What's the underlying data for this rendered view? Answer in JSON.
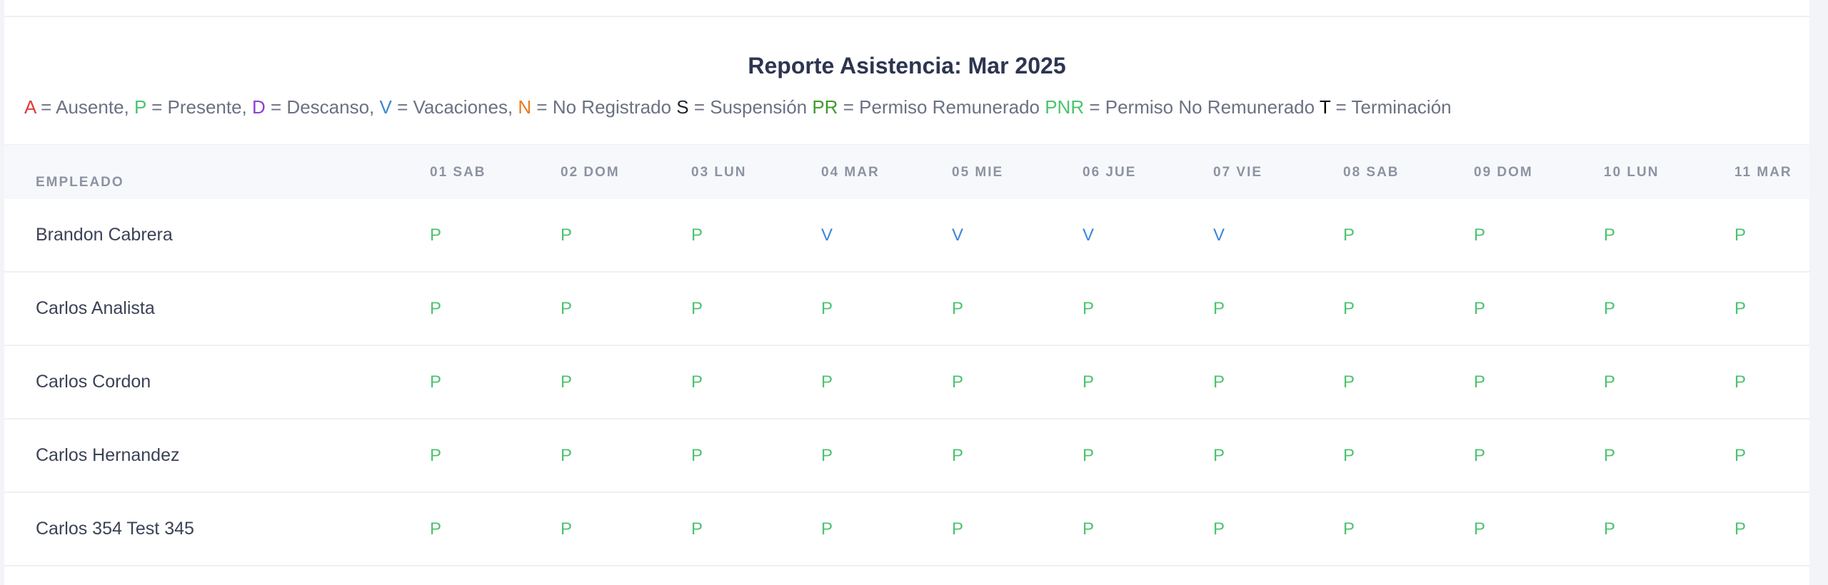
{
  "report": {
    "title": "Reporte Asistencia: Mar 2025"
  },
  "legend": [
    {
      "code": "A",
      "eq": " = Ausente, ",
      "color": "#e53935"
    },
    {
      "code": "P",
      "eq": " = Presente, ",
      "color": "#4cc36e"
    },
    {
      "code": "D",
      "eq": " = Descanso, ",
      "color": "#8e3fd6"
    },
    {
      "code": "V",
      "eq": " = Vacaciones, ",
      "color": "#3d86d6"
    },
    {
      "code": "N",
      "eq": " = No Registrado ",
      "color": "#ea7a1c"
    },
    {
      "code": "S",
      "eq": " = Suspensión ",
      "color": "#1f2430"
    },
    {
      "code": "PR",
      "eq": " = Permiso Remunerado ",
      "color": "#3f9b2e"
    },
    {
      "code": "PNR",
      "eq": " = Permiso No Remunerado ",
      "color": "#4cc36e"
    },
    {
      "code": "T",
      "eq": " = Terminación",
      "color": "#000000"
    }
  ],
  "status_colors": {
    "P": "#4cc36e",
    "V": "#3d86d6"
  },
  "table": {
    "employee_header": "EMPLEADO",
    "days": [
      "01 SAB",
      "02 DOM",
      "03 LUN",
      "04 MAR",
      "05 MIE",
      "06 JUE",
      "07 VIE",
      "08 SAB",
      "09 DOM",
      "10 LUN",
      "11 MAR"
    ],
    "rows": [
      {
        "name": "Brandon Cabrera",
        "values": [
          "P",
          "P",
          "P",
          "V",
          "V",
          "V",
          "V",
          "P",
          "P",
          "P",
          "P"
        ]
      },
      {
        "name": "Carlos Analista",
        "values": [
          "P",
          "P",
          "P",
          "P",
          "P",
          "P",
          "P",
          "P",
          "P",
          "P",
          "P"
        ]
      },
      {
        "name": "Carlos Cordon",
        "values": [
          "P",
          "P",
          "P",
          "P",
          "P",
          "P",
          "P",
          "P",
          "P",
          "P",
          "P"
        ]
      },
      {
        "name": "Carlos Hernandez",
        "values": [
          "P",
          "P",
          "P",
          "P",
          "P",
          "P",
          "P",
          "P",
          "P",
          "P",
          "P"
        ]
      },
      {
        "name": "Carlos 354 Test 345",
        "values": [
          "P",
          "P",
          "P",
          "P",
          "P",
          "P",
          "P",
          "P",
          "P",
          "P",
          "P"
        ]
      }
    ]
  }
}
